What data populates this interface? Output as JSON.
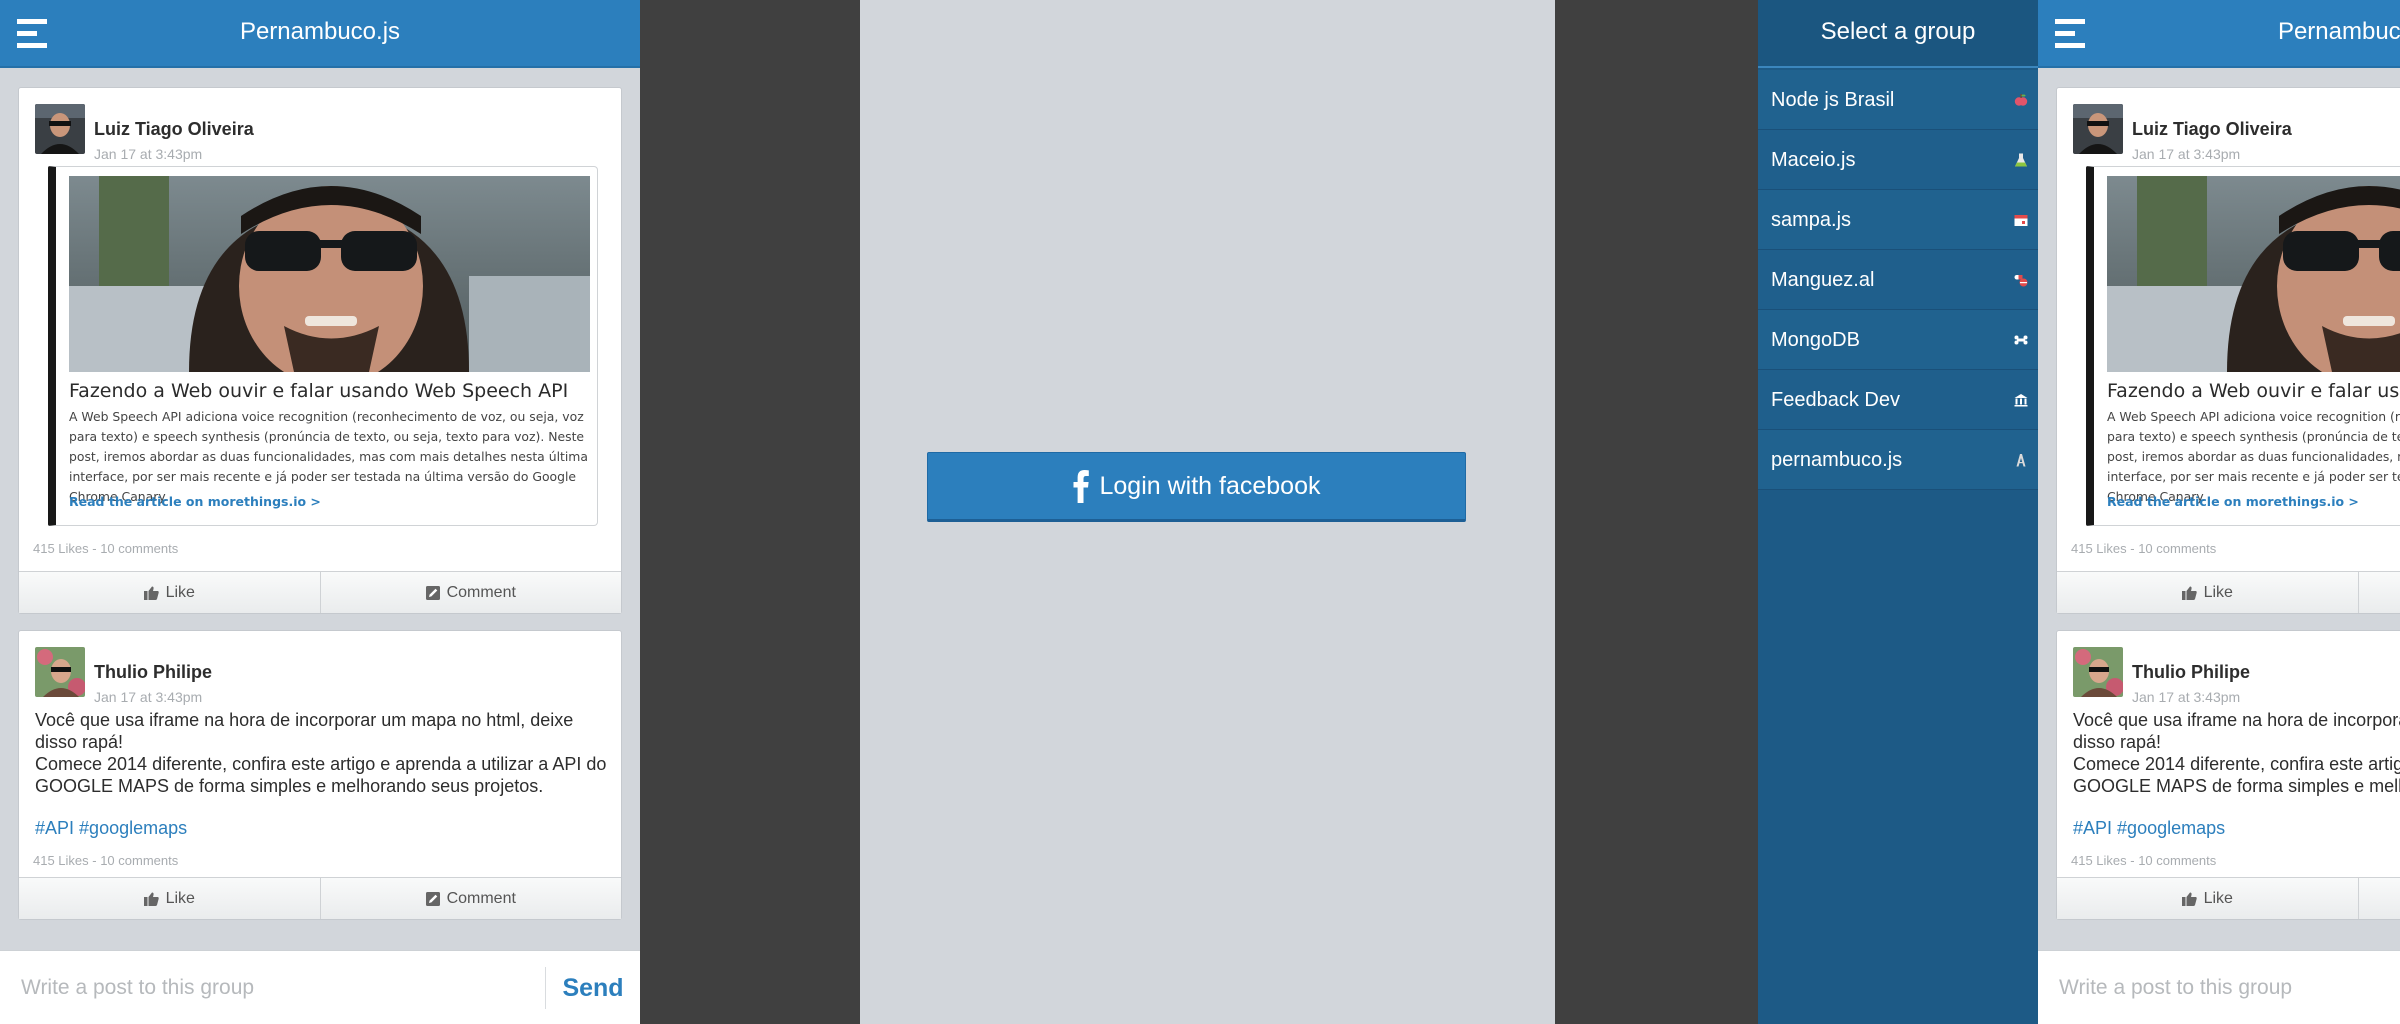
{
  "feed": {
    "title": "Pernambuco.js",
    "posts": [
      {
        "author": "Luiz Tiago Oliveira",
        "date": "Jan 17 at 3:43pm",
        "article": {
          "title": "Fazendo a Web ouvir e falar usando Web Speech API",
          "body": "A Web Speech API adiciona voice recognition (reconhecimento de voz, ou seja, voz para texto) e speech synthesis (pronúncia de texto, ou seja, texto para voz). Neste post, iremos abordar as duas funcionalidades, mas com mais detalhes nesta última interface, por ser mais recente e já poder ser testada na última versão do Google Chrome Canary.",
          "link": "Read the article on morethings.io >"
        },
        "meta": "415 Likes - 10 comments",
        "like_label": "Like",
        "comment_label": "Comment"
      },
      {
        "author": "Thulio Philipe",
        "date": "Jan 17 at 3:43pm",
        "text_lines": [
          "Você que usa iframe na hora de incorporar um mapa no html, deixe disso rapá!",
          "Comece 2014 diferente, confira este artigo e aprenda a utilizar a API do GOOGLE MAPS de forma simples e melhorando seus projetos."
        ],
        "tags": [
          "#API",
          "#googlemaps"
        ],
        "meta": "415 Likes - 10 comments",
        "like_label": "Like",
        "comment_label": "Comment"
      }
    ],
    "composer": {
      "placeholder": "Write a post to this group",
      "send_label": "Send"
    }
  },
  "login": {
    "button_label": "Login with facebook",
    "icon": "facebook-f-icon"
  },
  "groups": {
    "title": "Select a group",
    "items": [
      {
        "name": "Node js Brasil",
        "icon": "apple-icon"
      },
      {
        "name": "Maceio.js",
        "icon": "flask-icon"
      },
      {
        "name": "sampa.js",
        "icon": "calendar-icon"
      },
      {
        "name": "Manguez.al",
        "icon": "pills-icon"
      },
      {
        "name": "MongoDB",
        "icon": "bone-icon"
      },
      {
        "name": "Feedback Dev",
        "icon": "bank-icon"
      },
      {
        "name": "pernambuco.js",
        "icon": "tower-icon"
      }
    ]
  },
  "colors": {
    "brand_blue": "#2c7fbd",
    "groups_bg": "#1d5a86",
    "page_bg": "#d2d6db",
    "gutter": "#404040"
  }
}
